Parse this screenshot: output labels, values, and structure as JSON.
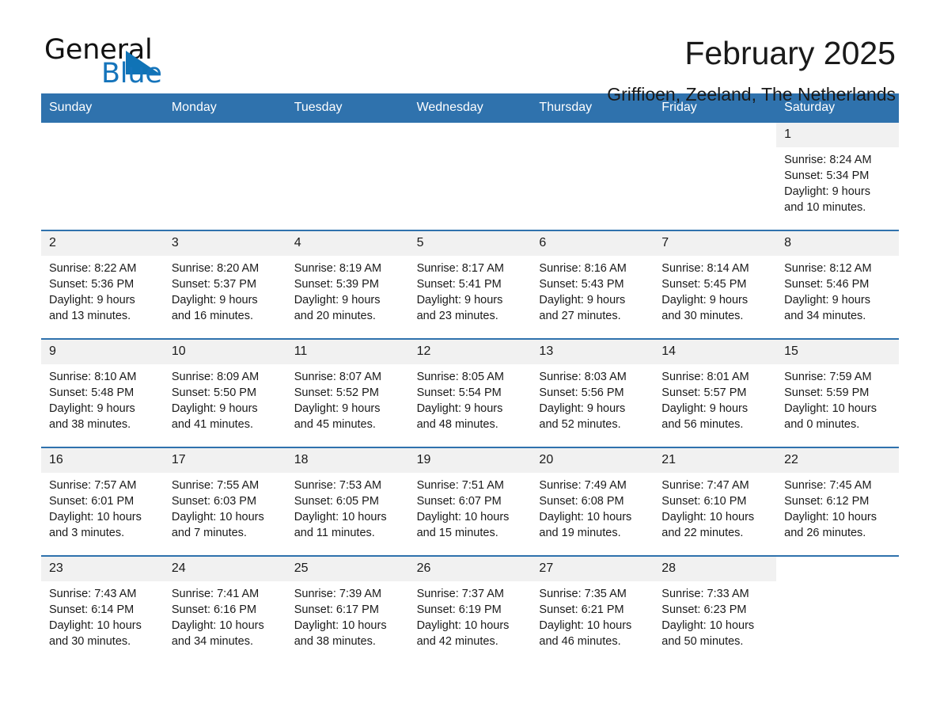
{
  "brand": {
    "name_part1": "General",
    "name_part2": "Blue",
    "flag_icon": "triangle-flag-icon",
    "accent_color": "#1073b6"
  },
  "header": {
    "title": "February 2025",
    "subtitle": "Griffioen, Zeeland, The Netherlands"
  },
  "calendar": {
    "header_bg": "#2f72ad",
    "day_band_bg": "#f1f1f1",
    "weekdays": [
      "Sunday",
      "Monday",
      "Tuesday",
      "Wednesday",
      "Thursday",
      "Friday",
      "Saturday"
    ],
    "weeks": [
      [
        {
          "day": "",
          "blank": true
        },
        {
          "day": "",
          "blank": true
        },
        {
          "day": "",
          "blank": true
        },
        {
          "day": "",
          "blank": true
        },
        {
          "day": "",
          "blank": true
        },
        {
          "day": "",
          "blank": true
        },
        {
          "day": "1",
          "sunrise": "Sunrise: 8:24 AM",
          "sunset": "Sunset: 5:34 PM",
          "daylight_line1": "Daylight: 9 hours",
          "daylight_line2": "and 10 minutes."
        }
      ],
      [
        {
          "day": "2",
          "sunrise": "Sunrise: 8:22 AM",
          "sunset": "Sunset: 5:36 PM",
          "daylight_line1": "Daylight: 9 hours",
          "daylight_line2": "and 13 minutes."
        },
        {
          "day": "3",
          "sunrise": "Sunrise: 8:20 AM",
          "sunset": "Sunset: 5:37 PM",
          "daylight_line1": "Daylight: 9 hours",
          "daylight_line2": "and 16 minutes."
        },
        {
          "day": "4",
          "sunrise": "Sunrise: 8:19 AM",
          "sunset": "Sunset: 5:39 PM",
          "daylight_line1": "Daylight: 9 hours",
          "daylight_line2": "and 20 minutes."
        },
        {
          "day": "5",
          "sunrise": "Sunrise: 8:17 AM",
          "sunset": "Sunset: 5:41 PM",
          "daylight_line1": "Daylight: 9 hours",
          "daylight_line2": "and 23 minutes."
        },
        {
          "day": "6",
          "sunrise": "Sunrise: 8:16 AM",
          "sunset": "Sunset: 5:43 PM",
          "daylight_line1": "Daylight: 9 hours",
          "daylight_line2": "and 27 minutes."
        },
        {
          "day": "7",
          "sunrise": "Sunrise: 8:14 AM",
          "sunset": "Sunset: 5:45 PM",
          "daylight_line1": "Daylight: 9 hours",
          "daylight_line2": "and 30 minutes."
        },
        {
          "day": "8",
          "sunrise": "Sunrise: 8:12 AM",
          "sunset": "Sunset: 5:46 PM",
          "daylight_line1": "Daylight: 9 hours",
          "daylight_line2": "and 34 minutes."
        }
      ],
      [
        {
          "day": "9",
          "sunrise": "Sunrise: 8:10 AM",
          "sunset": "Sunset: 5:48 PM",
          "daylight_line1": "Daylight: 9 hours",
          "daylight_line2": "and 38 minutes."
        },
        {
          "day": "10",
          "sunrise": "Sunrise: 8:09 AM",
          "sunset": "Sunset: 5:50 PM",
          "daylight_line1": "Daylight: 9 hours",
          "daylight_line2": "and 41 minutes."
        },
        {
          "day": "11",
          "sunrise": "Sunrise: 8:07 AM",
          "sunset": "Sunset: 5:52 PM",
          "daylight_line1": "Daylight: 9 hours",
          "daylight_line2": "and 45 minutes."
        },
        {
          "day": "12",
          "sunrise": "Sunrise: 8:05 AM",
          "sunset": "Sunset: 5:54 PM",
          "daylight_line1": "Daylight: 9 hours",
          "daylight_line2": "and 48 minutes."
        },
        {
          "day": "13",
          "sunrise": "Sunrise: 8:03 AM",
          "sunset": "Sunset: 5:56 PM",
          "daylight_line1": "Daylight: 9 hours",
          "daylight_line2": "and 52 minutes."
        },
        {
          "day": "14",
          "sunrise": "Sunrise: 8:01 AM",
          "sunset": "Sunset: 5:57 PM",
          "daylight_line1": "Daylight: 9 hours",
          "daylight_line2": "and 56 minutes."
        },
        {
          "day": "15",
          "sunrise": "Sunrise: 7:59 AM",
          "sunset": "Sunset: 5:59 PM",
          "daylight_line1": "Daylight: 10 hours",
          "daylight_line2": "and 0 minutes."
        }
      ],
      [
        {
          "day": "16",
          "sunrise": "Sunrise: 7:57 AM",
          "sunset": "Sunset: 6:01 PM",
          "daylight_line1": "Daylight: 10 hours",
          "daylight_line2": "and 3 minutes."
        },
        {
          "day": "17",
          "sunrise": "Sunrise: 7:55 AM",
          "sunset": "Sunset: 6:03 PM",
          "daylight_line1": "Daylight: 10 hours",
          "daylight_line2": "and 7 minutes."
        },
        {
          "day": "18",
          "sunrise": "Sunrise: 7:53 AM",
          "sunset": "Sunset: 6:05 PM",
          "daylight_line1": "Daylight: 10 hours",
          "daylight_line2": "and 11 minutes."
        },
        {
          "day": "19",
          "sunrise": "Sunrise: 7:51 AM",
          "sunset": "Sunset: 6:07 PM",
          "daylight_line1": "Daylight: 10 hours",
          "daylight_line2": "and 15 minutes."
        },
        {
          "day": "20",
          "sunrise": "Sunrise: 7:49 AM",
          "sunset": "Sunset: 6:08 PM",
          "daylight_line1": "Daylight: 10 hours",
          "daylight_line2": "and 19 minutes."
        },
        {
          "day": "21",
          "sunrise": "Sunrise: 7:47 AM",
          "sunset": "Sunset: 6:10 PM",
          "daylight_line1": "Daylight: 10 hours",
          "daylight_line2": "and 22 minutes."
        },
        {
          "day": "22",
          "sunrise": "Sunrise: 7:45 AM",
          "sunset": "Sunset: 6:12 PM",
          "daylight_line1": "Daylight: 10 hours",
          "daylight_line2": "and 26 minutes."
        }
      ],
      [
        {
          "day": "23",
          "sunrise": "Sunrise: 7:43 AM",
          "sunset": "Sunset: 6:14 PM",
          "daylight_line1": "Daylight: 10 hours",
          "daylight_line2": "and 30 minutes."
        },
        {
          "day": "24",
          "sunrise": "Sunrise: 7:41 AM",
          "sunset": "Sunset: 6:16 PM",
          "daylight_line1": "Daylight: 10 hours",
          "daylight_line2": "and 34 minutes."
        },
        {
          "day": "25",
          "sunrise": "Sunrise: 7:39 AM",
          "sunset": "Sunset: 6:17 PM",
          "daylight_line1": "Daylight: 10 hours",
          "daylight_line2": "and 38 minutes."
        },
        {
          "day": "26",
          "sunrise": "Sunrise: 7:37 AM",
          "sunset": "Sunset: 6:19 PM",
          "daylight_line1": "Daylight: 10 hours",
          "daylight_line2": "and 42 minutes."
        },
        {
          "day": "27",
          "sunrise": "Sunrise: 7:35 AM",
          "sunset": "Sunset: 6:21 PM",
          "daylight_line1": "Daylight: 10 hours",
          "daylight_line2": "and 46 minutes."
        },
        {
          "day": "28",
          "sunrise": "Sunrise: 7:33 AM",
          "sunset": "Sunset: 6:23 PM",
          "daylight_line1": "Daylight: 10 hours",
          "daylight_line2": "and 50 minutes."
        },
        {
          "day": "",
          "blank": true
        }
      ]
    ]
  }
}
